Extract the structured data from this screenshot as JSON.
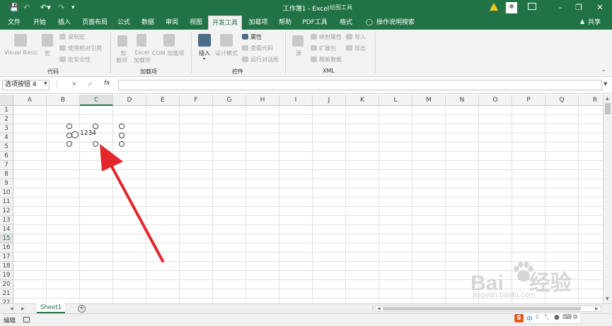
{
  "titlebar": {
    "title": "工作簿1 - Excel",
    "context_label": "绘图工具",
    "icons": [
      "save-icon",
      "undo-icon",
      "redo-icon",
      "customize-icon",
      "warning-icon",
      "user-avatar",
      "ribbon-display-icon",
      "minimize-icon",
      "restore-icon",
      "close-icon"
    ]
  },
  "tabs": [
    "文件",
    "开始",
    "插入",
    "页面布局",
    "公式",
    "数据",
    "审阅",
    "视图",
    "开发工具",
    "加载项",
    "帮助",
    "PDF工具",
    "格式"
  ],
  "active_tab": "开发工具",
  "tell_me": "操作说明搜索",
  "share": "共享",
  "ribbon": {
    "code": {
      "visual_basic": "Visual Basic",
      "macros": "宏",
      "record_macro": "录制宏",
      "relative_refs": "使用相对引用",
      "macro_security": "宏安全性",
      "group": "代码"
    },
    "addins": {
      "addins_line1": "加",
      "addins_line2": "载项",
      "excel_addins_line1": "Excel",
      "excel_addins_line2": "加载项",
      "com_addins": "COM 加载项",
      "group": "加载项"
    },
    "controls": {
      "insert": "插入",
      "design_mode": "设计模式",
      "properties": "属性",
      "view_code": "查看代码",
      "run_dialog": "运行对话框",
      "group": "控件"
    },
    "xml": {
      "source": "源",
      "map_properties": "映射属性",
      "expansion_packs": "扩展包",
      "refresh_data": "刷新数据",
      "import": "导入",
      "export": "导出",
      "group": "XML"
    }
  },
  "formula_bar": {
    "name_box": "选项按钮 4",
    "fx": "fx",
    "cancel": "✕",
    "enter": "✓",
    "formula": ""
  },
  "grid": {
    "columns": [
      "A",
      "B",
      "C",
      "D",
      "E",
      "F",
      "G",
      "H",
      "I",
      "J",
      "K",
      "L",
      "M",
      "N",
      "O",
      "P",
      "Q",
      "R"
    ],
    "rows": [
      "1",
      "2",
      "3",
      "4",
      "5",
      "6",
      "7",
      "8",
      "9",
      "10",
      "11",
      "12",
      "13",
      "14",
      "15",
      "16",
      "17",
      "18",
      "19",
      "20",
      "21",
      "22"
    ],
    "selected_column": "C",
    "selected_row": "15"
  },
  "control": {
    "label": "1234"
  },
  "sheets": [
    "Sheet1"
  ],
  "status": {
    "mode": "编辑"
  },
  "watermark": {
    "brand": "Bai",
    "brand2": "经验",
    "url": "jingyan.baidu.com"
  },
  "ime": {
    "brand": "S",
    "lang": "中"
  },
  "colors": {
    "excel_green": "#217346",
    "arrow_red": "#e3262b"
  }
}
